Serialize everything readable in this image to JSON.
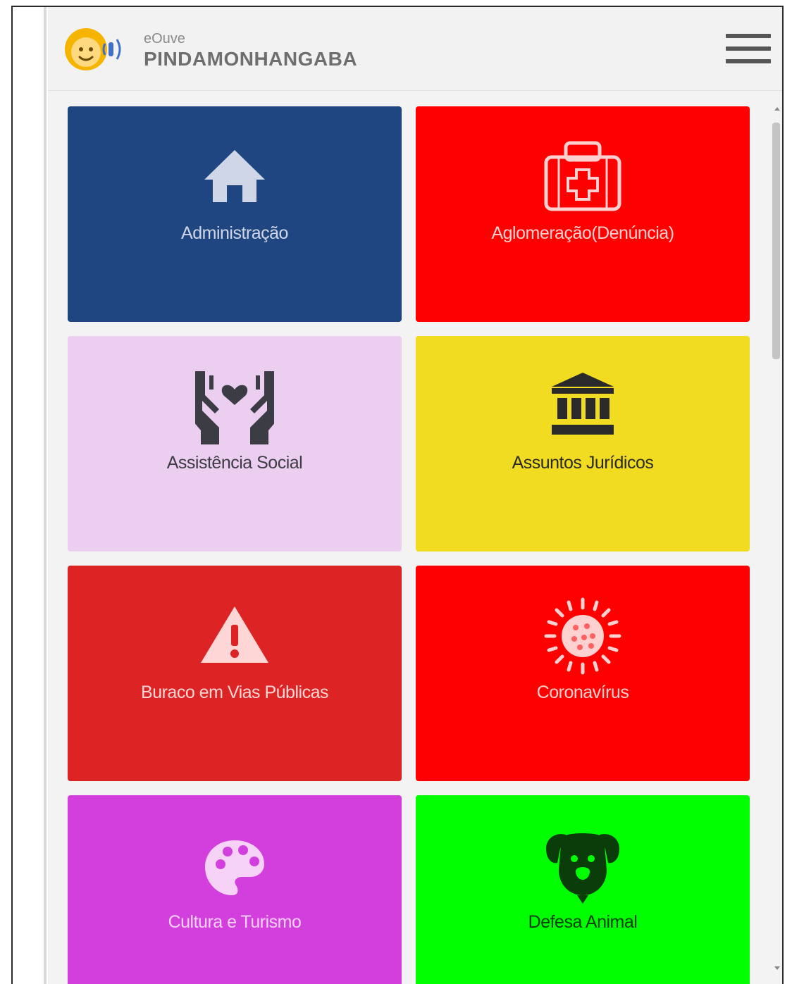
{
  "header": {
    "app_name": "eOuve",
    "city": "PINDAMONHANGABA",
    "logo_icon": "mascot-face-sound-icon",
    "menu_icon": "hamburger-menu-icon"
  },
  "categories": [
    {
      "label": "Administração",
      "icon": "home-icon",
      "bg": "#1f4680",
      "fg": "#cfd6e8"
    },
    {
      "label": "Aglomeração(Denúncia)",
      "icon": "first-aid-kit-icon",
      "bg": "#ff0000",
      "fg": "#ffd0d0"
    },
    {
      "label": "Assistência Social",
      "icon": "hands-heart-icon",
      "bg": "#eccff0",
      "fg": "#3c3c44"
    },
    {
      "label": "Assuntos Jurídicos",
      "icon": "courthouse-icon",
      "bg": "#f2dc22",
      "fg": "#2a2a2a"
    },
    {
      "label": "Buraco em Vias Públicas",
      "icon": "warning-triangle-icon",
      "bg": "#dd2424",
      "fg": "#ffd6d6"
    },
    {
      "label": "Coronavírus",
      "icon": "virus-icon",
      "bg": "#ff0000",
      "fg": "#ffd0d0"
    },
    {
      "label": "Cultura e Turismo",
      "icon": "palette-icon",
      "bg": "#d33fdd",
      "fg": "#f6d2f6"
    },
    {
      "label": "Defesa Animal",
      "icon": "dog-icon",
      "bg": "#00ff00",
      "fg": "#0a3d0a"
    }
  ]
}
